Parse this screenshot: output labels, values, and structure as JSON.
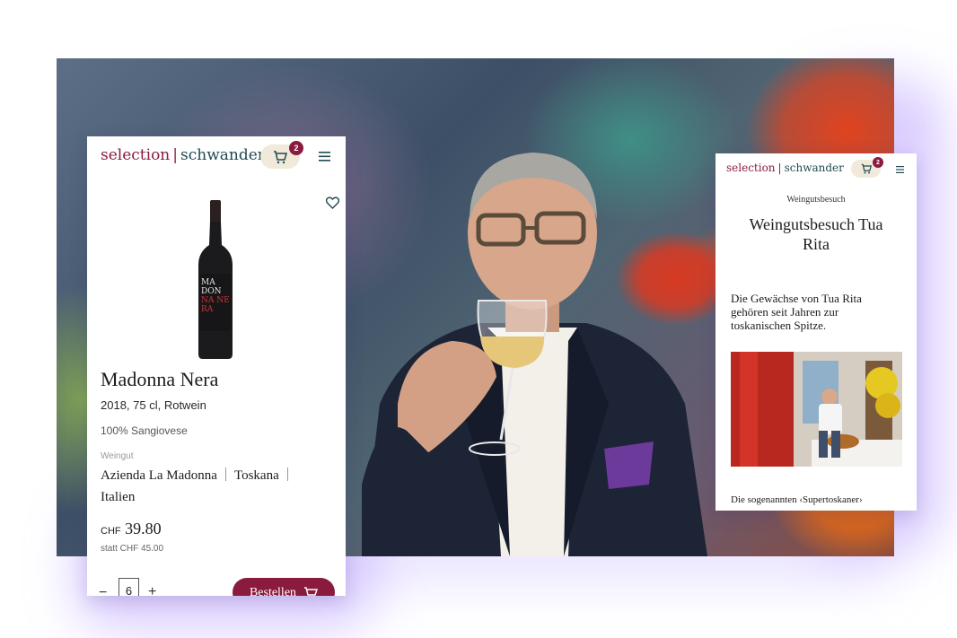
{
  "left_card": {
    "brand": {
      "part1": "selection",
      "separator": "|",
      "part2": "schwander"
    },
    "cart_count": "2",
    "product": {
      "name": "Madonna Nera",
      "meta": "2018, 75 cl, Rotwein",
      "grape": "100% Sangiovese",
      "winery_label": "Weingut",
      "winery": "Azienda La Madonna",
      "region": "Toskana",
      "country": "Italien",
      "currency": "CHF",
      "price": "39.80",
      "old_price": "statt CHF 45.00",
      "bottle_label_lines": [
        "MA",
        "DON",
        "NA NE",
        "RA"
      ]
    },
    "quantity": "6",
    "order_label": "Bestellen",
    "minus": "−",
    "plus": "+"
  },
  "right_card": {
    "brand": {
      "part1": "selection",
      "separator": "|",
      "part2": "schwander"
    },
    "cart_count": "2",
    "category": "Weingutsbesuch",
    "title": "Weingutsbesuch Tua Rita",
    "intro": "Die Gewächse von Tua Rita gehören seit Jahren zur toskanischen Spitze.",
    "teaser": "Die sogenannten ‹Supertoskaner›"
  },
  "colors": {
    "brand_wine": "#8a1b3f",
    "brand_teal": "#1f4a52",
    "cart_pill": "#f1e9d9",
    "glow": "#966eff"
  },
  "icons": [
    "cart-icon",
    "menu-icon",
    "heart-icon"
  ]
}
